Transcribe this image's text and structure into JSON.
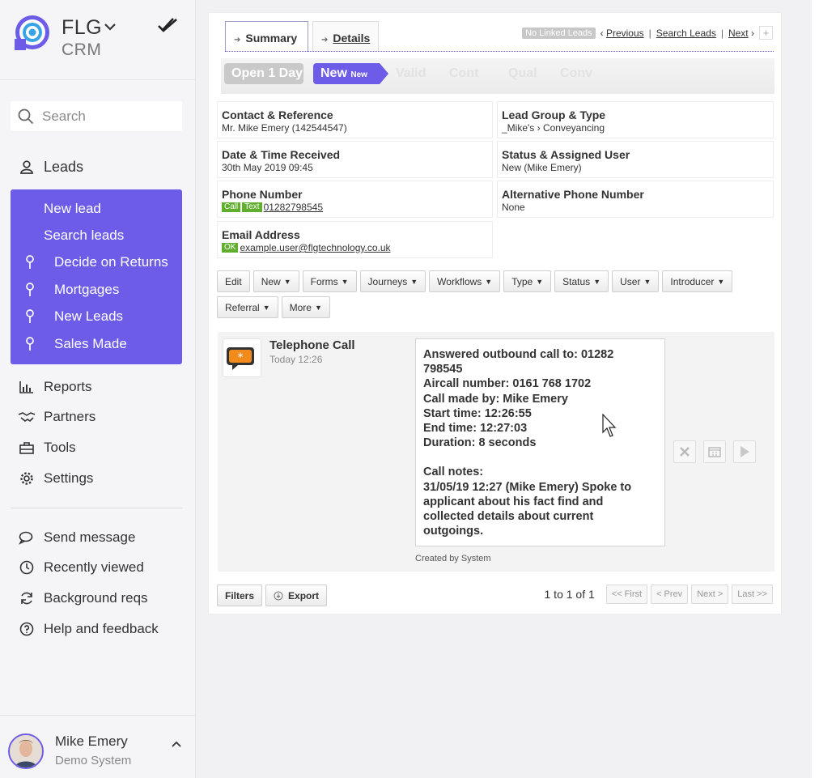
{
  "brand": {
    "name": "FLG",
    "sub": "CRM",
    "accent": "#6c5ce7"
  },
  "search": {
    "placeholder": "Search"
  },
  "nav": {
    "leads": "Leads",
    "lead_items": [
      "New lead",
      "Search leads",
      "Decide on Returns",
      "Mortgages",
      "New Leads",
      "Sales Made"
    ],
    "reports": "Reports",
    "partners": "Partners",
    "tools": "Tools",
    "settings": "Settings",
    "send_message": "Send message",
    "recently_viewed": "Recently viewed",
    "background_reqs": "Background reqs",
    "help": "Help and feedback"
  },
  "user": {
    "name": "Mike Emery",
    "sub": "Demo System"
  },
  "tabs": {
    "summary": "Summary",
    "details": "Details"
  },
  "toplinks": {
    "no_linked": "No Linked Leads",
    "previous": "Previous",
    "search_leads": "Search Leads",
    "next": "Next",
    "plus": "+"
  },
  "stages": {
    "open": "Open 1 Day",
    "new": "New",
    "new_small": "New",
    "valid": "Valid",
    "cont": "Cont",
    "qual": "Qual",
    "conv": "Conv"
  },
  "fields": {
    "contact_label": "Contact & Reference",
    "contact_value": "Mr. Mike Emery (142544547)",
    "group_label": "Lead Group & Type",
    "group_value": "_Mike's › Conveyancing",
    "date_label": "Date & Time Received",
    "date_value": "30th May 2019 09:45",
    "status_label": "Status & Assigned User",
    "status_value": "New (Mike Emery)",
    "phone_label": "Phone Number",
    "phone_call": "Call",
    "phone_text": "Text",
    "phone_value": "01282798545",
    "alt_label": "Alternative Phone Number",
    "alt_value": "None",
    "email_label": "Email Address",
    "email_ok": "OK",
    "email_value": "example.user@flgtechnology.co.uk"
  },
  "buttons": {
    "edit": "Edit",
    "new": "New",
    "forms": "Forms",
    "journeys": "Journeys",
    "workflows": "Workflows",
    "type": "Type",
    "status": "Status",
    "user": "User",
    "introducer": "Introducer",
    "referral": "Referral",
    "more": "More"
  },
  "timeline": {
    "title": "Telephone Call",
    "time": "Today 12:26",
    "note_lines": [
      "Answered outbound call to: 01282",
      "798545",
      "Aircall number: 0161 768 1702",
      "Call made by: Mike Emery",
      "Start time: 12:26:55",
      "End time: 12:27:03",
      "Duration: 8 seconds",
      "",
      "Call notes:",
      "31/05/19 12:27 (Mike Emery) Spoke to",
      "applicant about his fact find and",
      "collected details about current",
      "outgoings."
    ],
    "created": "Created by System"
  },
  "footer": {
    "filters": "Filters",
    "export": "Export",
    "count": "1 to 1 of 1",
    "first": "<< First",
    "prev": "< Prev",
    "next": "Next >",
    "last": "Last >>"
  }
}
